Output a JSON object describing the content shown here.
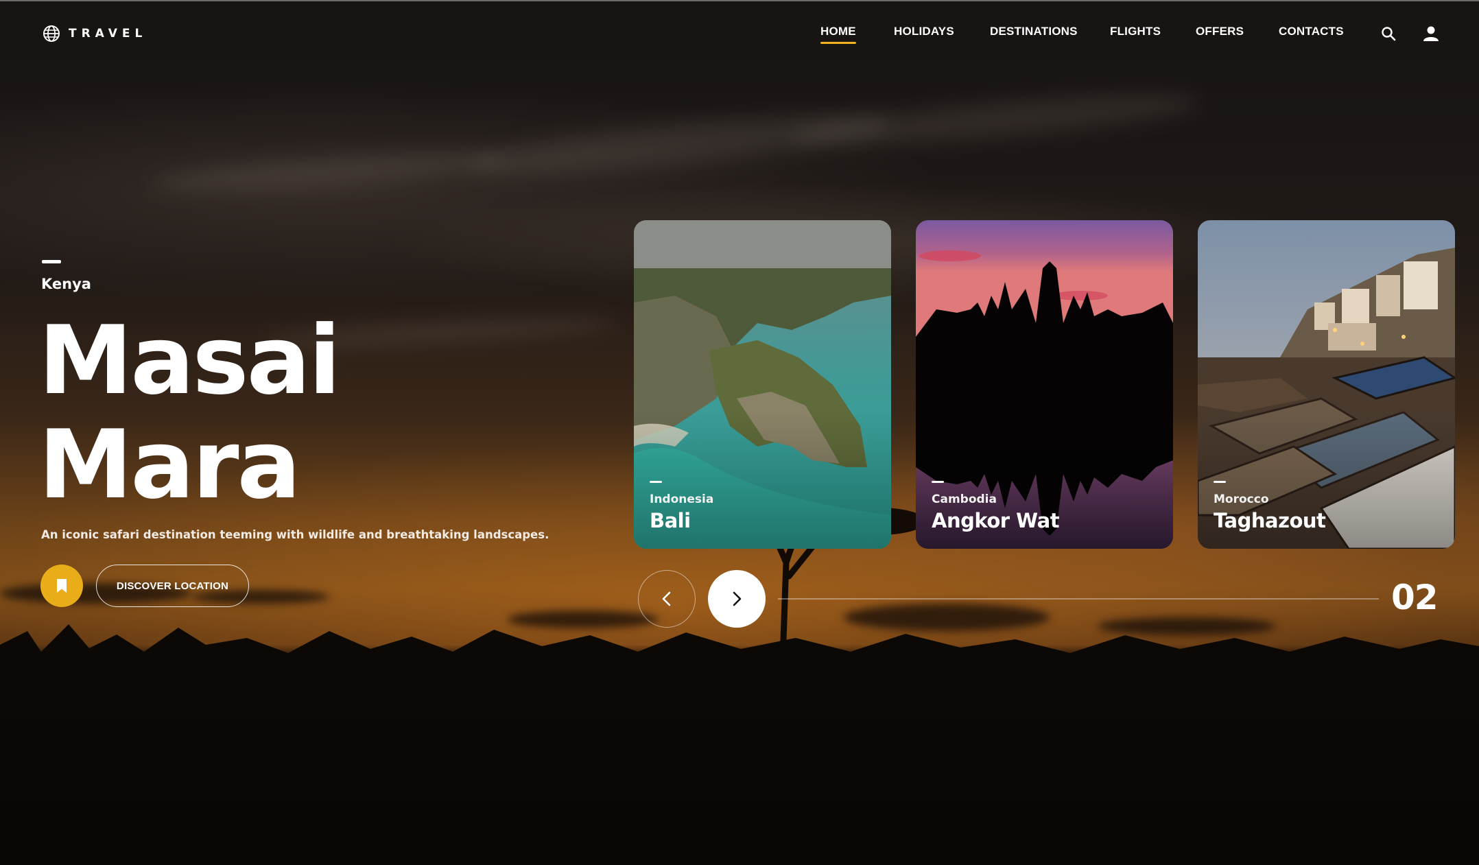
{
  "brand": {
    "name": "TRAVEL",
    "icon": "globe-icon"
  },
  "nav": {
    "items": [
      {
        "label": "HOME",
        "active": true
      },
      {
        "label": "HOLIDAYS",
        "active": false
      },
      {
        "label": "DESTINATIONS",
        "active": false
      },
      {
        "label": "FLIGHTS",
        "active": false
      },
      {
        "label": "OFFERS",
        "active": false
      },
      {
        "label": "CONTACTS",
        "active": false
      }
    ],
    "icons": [
      "search-icon",
      "user-icon"
    ]
  },
  "hero": {
    "country": "Kenya",
    "title_line1": "Masai",
    "title_line2": "Mara",
    "description": "An iconic safari destination teeming with wildlife and breathtaking landscapes.",
    "bookmark_icon": "bookmark-icon",
    "cta_label": "DISCOVER LOCATION"
  },
  "cards": [
    {
      "country": "Indonesia",
      "name": "Bali"
    },
    {
      "country": "Cambodia",
      "name": "Angkor Wat"
    },
    {
      "country": "Morocco",
      "name": "Taghazout"
    }
  ],
  "slider": {
    "current": "02",
    "prev_icon": "chevron-left-icon",
    "next_icon": "chevron-right-icon",
    "progress": 0
  },
  "colors": {
    "accent": "#f2b320",
    "bookmark": "#e9ad19"
  }
}
